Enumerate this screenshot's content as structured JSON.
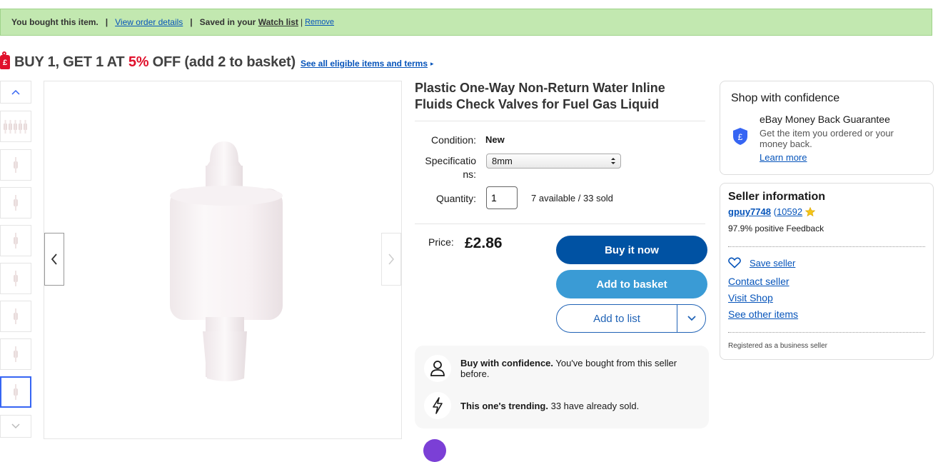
{
  "banner": {
    "bought": "You bought this item.",
    "separator": "|",
    "view_order": "View order details",
    "saved_prefix": "Saved in your",
    "watch_list": "Watch list",
    "separator2": "|",
    "remove": "Remove"
  },
  "promo": {
    "part1": "BUY 1, GET 1 AT ",
    "percent": "5%",
    "part2": " OFF (add 2 to basket)",
    "link": "See all eligible items and terms",
    "arrow": "▸",
    "icon_text": "£"
  },
  "product": {
    "title": "Plastic One-Way Non-Return Water Inline Fluids Check Valves for Fuel Gas Liquid",
    "condition_label": "Condition:",
    "condition_value": "New",
    "spec_label_1": "Specificatio",
    "spec_label_2": "ns:",
    "spec_value": "8mm",
    "qty_label": "Quantity:",
    "qty_value": "1",
    "availability": "7 available / 33 sold",
    "price_label": "Price:",
    "price": "£2.86"
  },
  "actions": {
    "buy_now": "Buy it now",
    "add_to_basket": "Add to basket",
    "add_to_list": "Add to list"
  },
  "confidence_box": {
    "item1_bold": "Buy with confidence.",
    "item1_text": " You've bought from this seller before.",
    "item2_bold": "This one's trending.",
    "item2_text": " 33 have already sold."
  },
  "shop_confidence": {
    "title": "Shop with confidence",
    "guarantee_title": "eBay Money Back Guarantee",
    "guarantee_text": "Get the item you ordered or your money back.",
    "learn_more": "Learn more",
    "icon_text": "£"
  },
  "seller": {
    "title": "Seller information",
    "name": "gpuy7748",
    "open_paren": "(",
    "feedback_count": "10592",
    "feedback_pct": "97.9% positive Feedback",
    "save_seller": "Save seller",
    "contact": "Contact seller",
    "visit_shop": "Visit Shop",
    "other_items": "See other items",
    "registered": "Registered as a business seller"
  },
  "colors": {
    "banner_bg": "#c2e8b0",
    "promo_red": "#e0102b",
    "buy_now": "#0052a3",
    "add_to_basket": "#3a9bd5",
    "link": "#0654ba"
  },
  "icons": [
    "tag-icon",
    "chevron-up-icon",
    "chevron-down-icon",
    "chevron-left-icon",
    "chevron-right-icon",
    "shield-pound-icon",
    "person-icon",
    "lightning-icon",
    "heart-icon",
    "star-icon"
  ]
}
